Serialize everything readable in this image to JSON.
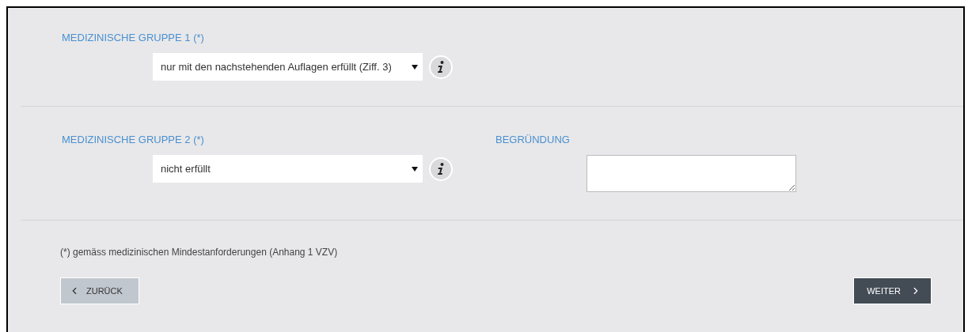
{
  "sections": [
    {
      "label": "MEDIZINISCHE GRUPPE 1 (*)",
      "select": {
        "value": "nur mit den nachstehenden Auflagen erfüllt (Ziff. 3)"
      }
    },
    {
      "label": "MEDIZINISCHE GRUPPE 2 (*)",
      "select": {
        "value": "nicht erfüllt"
      },
      "reason": {
        "label": "BEGRÜNDUNG"
      }
    }
  ],
  "footnote": "(*) gemäss medizinischen Mindestanforderungen (Anhang 1 VZV)",
  "buttons": {
    "back": "ZURÜCK",
    "next": "WEITER"
  }
}
